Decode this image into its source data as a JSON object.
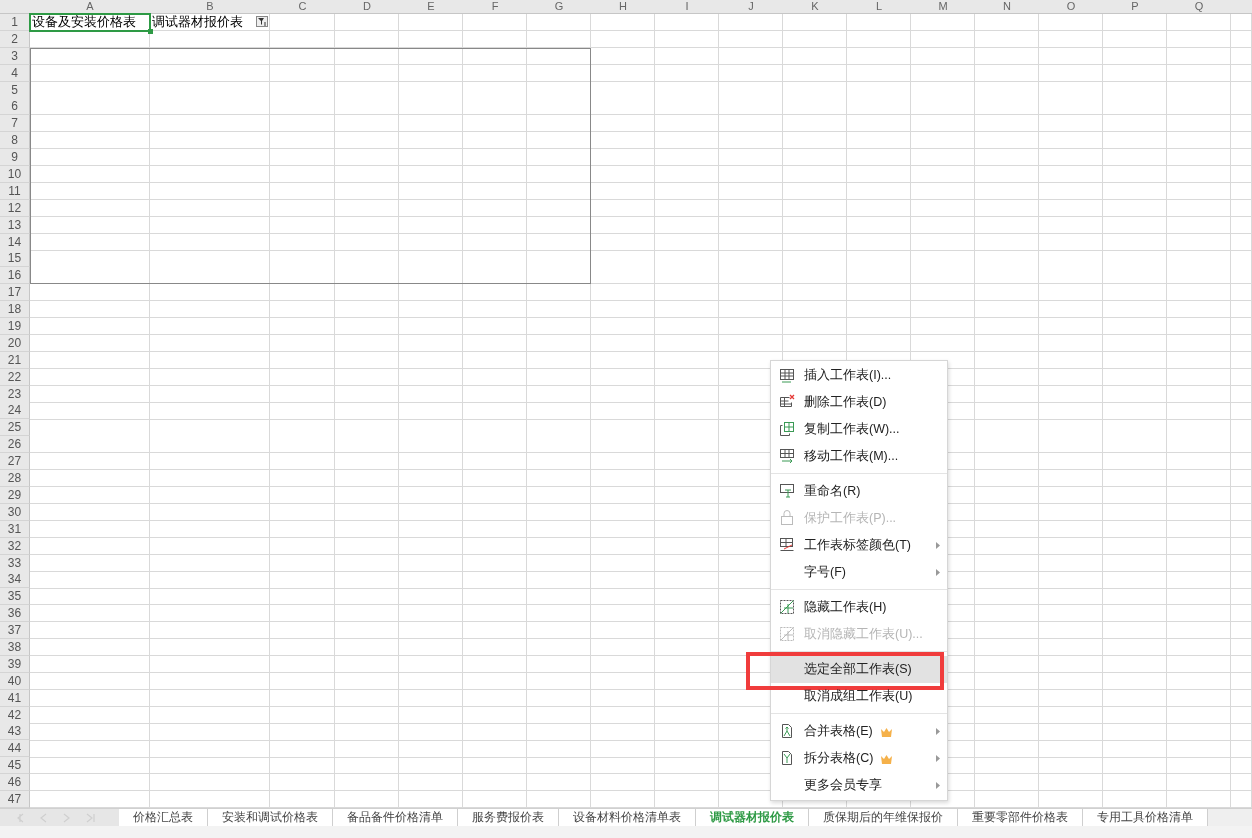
{
  "columns": [
    "A",
    "B",
    "C",
    "D",
    "E",
    "F",
    "G",
    "H",
    "I",
    "J",
    "K",
    "L",
    "M",
    "N",
    "O",
    "P",
    "Q"
  ],
  "row_numbers": [
    "1",
    "2",
    "3",
    "4",
    "5",
    "6",
    "7",
    "8",
    "9",
    "10",
    "11",
    "12",
    "13",
    "14",
    "15",
    "16",
    "17",
    "18",
    "19",
    "20",
    "21",
    "22",
    "23",
    "24",
    "25",
    "26",
    "27",
    "28",
    "29",
    "30",
    "31",
    "32",
    "33",
    "34",
    "35",
    "36",
    "37",
    "38",
    "39",
    "40",
    "41",
    "42",
    "43",
    "44",
    "45",
    "46",
    "47"
  ],
  "row_1": [
    {
      "text": "设备及安装价格表",
      "selected": true,
      "filter": false
    },
    {
      "text": "调试器材报价表",
      "selected": false,
      "filter": true
    }
  ],
  "sheet_tabs": [
    {
      "label": "价格汇总表",
      "selected": false
    },
    {
      "label": "安装和调试价格表",
      "selected": false
    },
    {
      "label": "备品备件价格清单",
      "selected": false
    },
    {
      "label": "服务费报价表",
      "selected": false
    },
    {
      "label": "设备材料价格清单表",
      "selected": false
    },
    {
      "label": "调试器材报价表",
      "selected": true
    },
    {
      "label": "质保期后的年维保报价",
      "selected": false
    },
    {
      "label": "重要零部件价格表",
      "selected": false
    },
    {
      "label": "专用工具价格清单",
      "selected": false
    }
  ],
  "context_menu": {
    "groups": [
      [
        {
          "label": "插入工作表(I)...",
          "disabled": false,
          "submenu": false,
          "premium": false,
          "selected": false,
          "outlined": false
        },
        {
          "label": "删除工作表(D)",
          "disabled": false,
          "submenu": false,
          "premium": false,
          "selected": false,
          "outlined": false
        },
        {
          "label": "复制工作表(W)...",
          "disabled": false,
          "submenu": false,
          "premium": false,
          "selected": false,
          "outlined": false
        },
        {
          "label": "移动工作表(M)...",
          "disabled": false,
          "submenu": false,
          "premium": false,
          "selected": false,
          "outlined": false
        }
      ],
      [
        {
          "label": "重命名(R)",
          "disabled": false,
          "submenu": false,
          "premium": false,
          "selected": false,
          "outlined": false
        },
        {
          "label": "保护工作表(P)...",
          "disabled": true,
          "submenu": false,
          "premium": false,
          "selected": false,
          "outlined": false
        },
        {
          "label": "工作表标签颜色(T)",
          "disabled": false,
          "submenu": true,
          "premium": false,
          "selected": false,
          "outlined": false
        },
        {
          "label": "字号(F)",
          "disabled": false,
          "submenu": true,
          "premium": false,
          "selected": false,
          "outlined": false
        }
      ],
      [
        {
          "label": "隐藏工作表(H)",
          "disabled": false,
          "submenu": false,
          "premium": false,
          "selected": false,
          "outlined": false
        },
        {
          "label": "取消隐藏工作表(U)...",
          "disabled": true,
          "submenu": false,
          "premium": false,
          "selected": false,
          "outlined": false
        }
      ],
      [
        {
          "label": "选定全部工作表(S)",
          "disabled": false,
          "submenu": false,
          "premium": false,
          "selected": true,
          "outlined": true
        },
        {
          "label": "取消成组工作表(U)",
          "disabled": false,
          "submenu": false,
          "premium": false,
          "selected": false,
          "outlined": false
        }
      ],
      [
        {
          "label": "合并表格(E)",
          "disabled": false,
          "submenu": true,
          "premium": true,
          "selected": false,
          "outlined": false
        },
        {
          "label": "拆分表格(C)",
          "disabled": false,
          "submenu": true,
          "premium": true,
          "selected": false,
          "outlined": false
        },
        {
          "label": "更多会员专享",
          "disabled": false,
          "submenu": true,
          "premium": false,
          "selected": false,
          "outlined": false
        }
      ]
    ]
  }
}
